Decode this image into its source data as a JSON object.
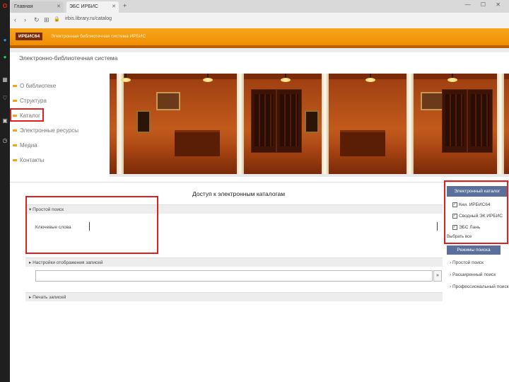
{
  "browser": {
    "tabs": [
      {
        "label": "Главная"
      },
      {
        "label": "ЭБС ИРБИС"
      }
    ],
    "window_controls": "— ☐ ✕",
    "url": "irbis.library.ru/catalog",
    "sidebar_icons": [
      "opera-icon",
      "messenger-icon",
      "whatsapp-icon",
      "feed-icon",
      "heart-icon",
      "box-icon",
      "history-icon"
    ]
  },
  "banner": {
    "logo": "ИРБИС64",
    "text": "Электронная библиотечная система ИРБИС"
  },
  "site_title": "Электронно-библиотечная система",
  "menu": {
    "items": [
      {
        "label": "О библиотеке"
      },
      {
        "label": "Структура"
      },
      {
        "label": "Каталог"
      },
      {
        "label": "Электронные ресурсы"
      },
      {
        "label": "Медиа"
      },
      {
        "label": "Контакты"
      }
    ]
  },
  "main": {
    "heading": "Доступ к электронным каталогам",
    "simple_search": "Простой поиск",
    "keyword_label": "Ключевые слова",
    "display_settings": "Настройки отображения записей",
    "search_button": "»",
    "print_records": "Печать записей"
  },
  "catalogs": {
    "header": "Электронный каталог",
    "items": [
      {
        "label": "Кни. ИРБИС64"
      },
      {
        "label": "Сводный ЭК ИРБИС"
      },
      {
        "label": "ЭБС Лань"
      }
    ],
    "choose_all": "Выбрать все"
  },
  "modes": {
    "header": "Режимы поиска",
    "items": [
      {
        "label": "Простой поиск"
      },
      {
        "label": "Расширенный поиск"
      },
      {
        "label": "Профессиональный поиск"
      }
    ]
  },
  "colors": {
    "accent_orange": "#f08a00",
    "panel_blue": "#5a6f99",
    "highlight_red": "#e02020"
  }
}
